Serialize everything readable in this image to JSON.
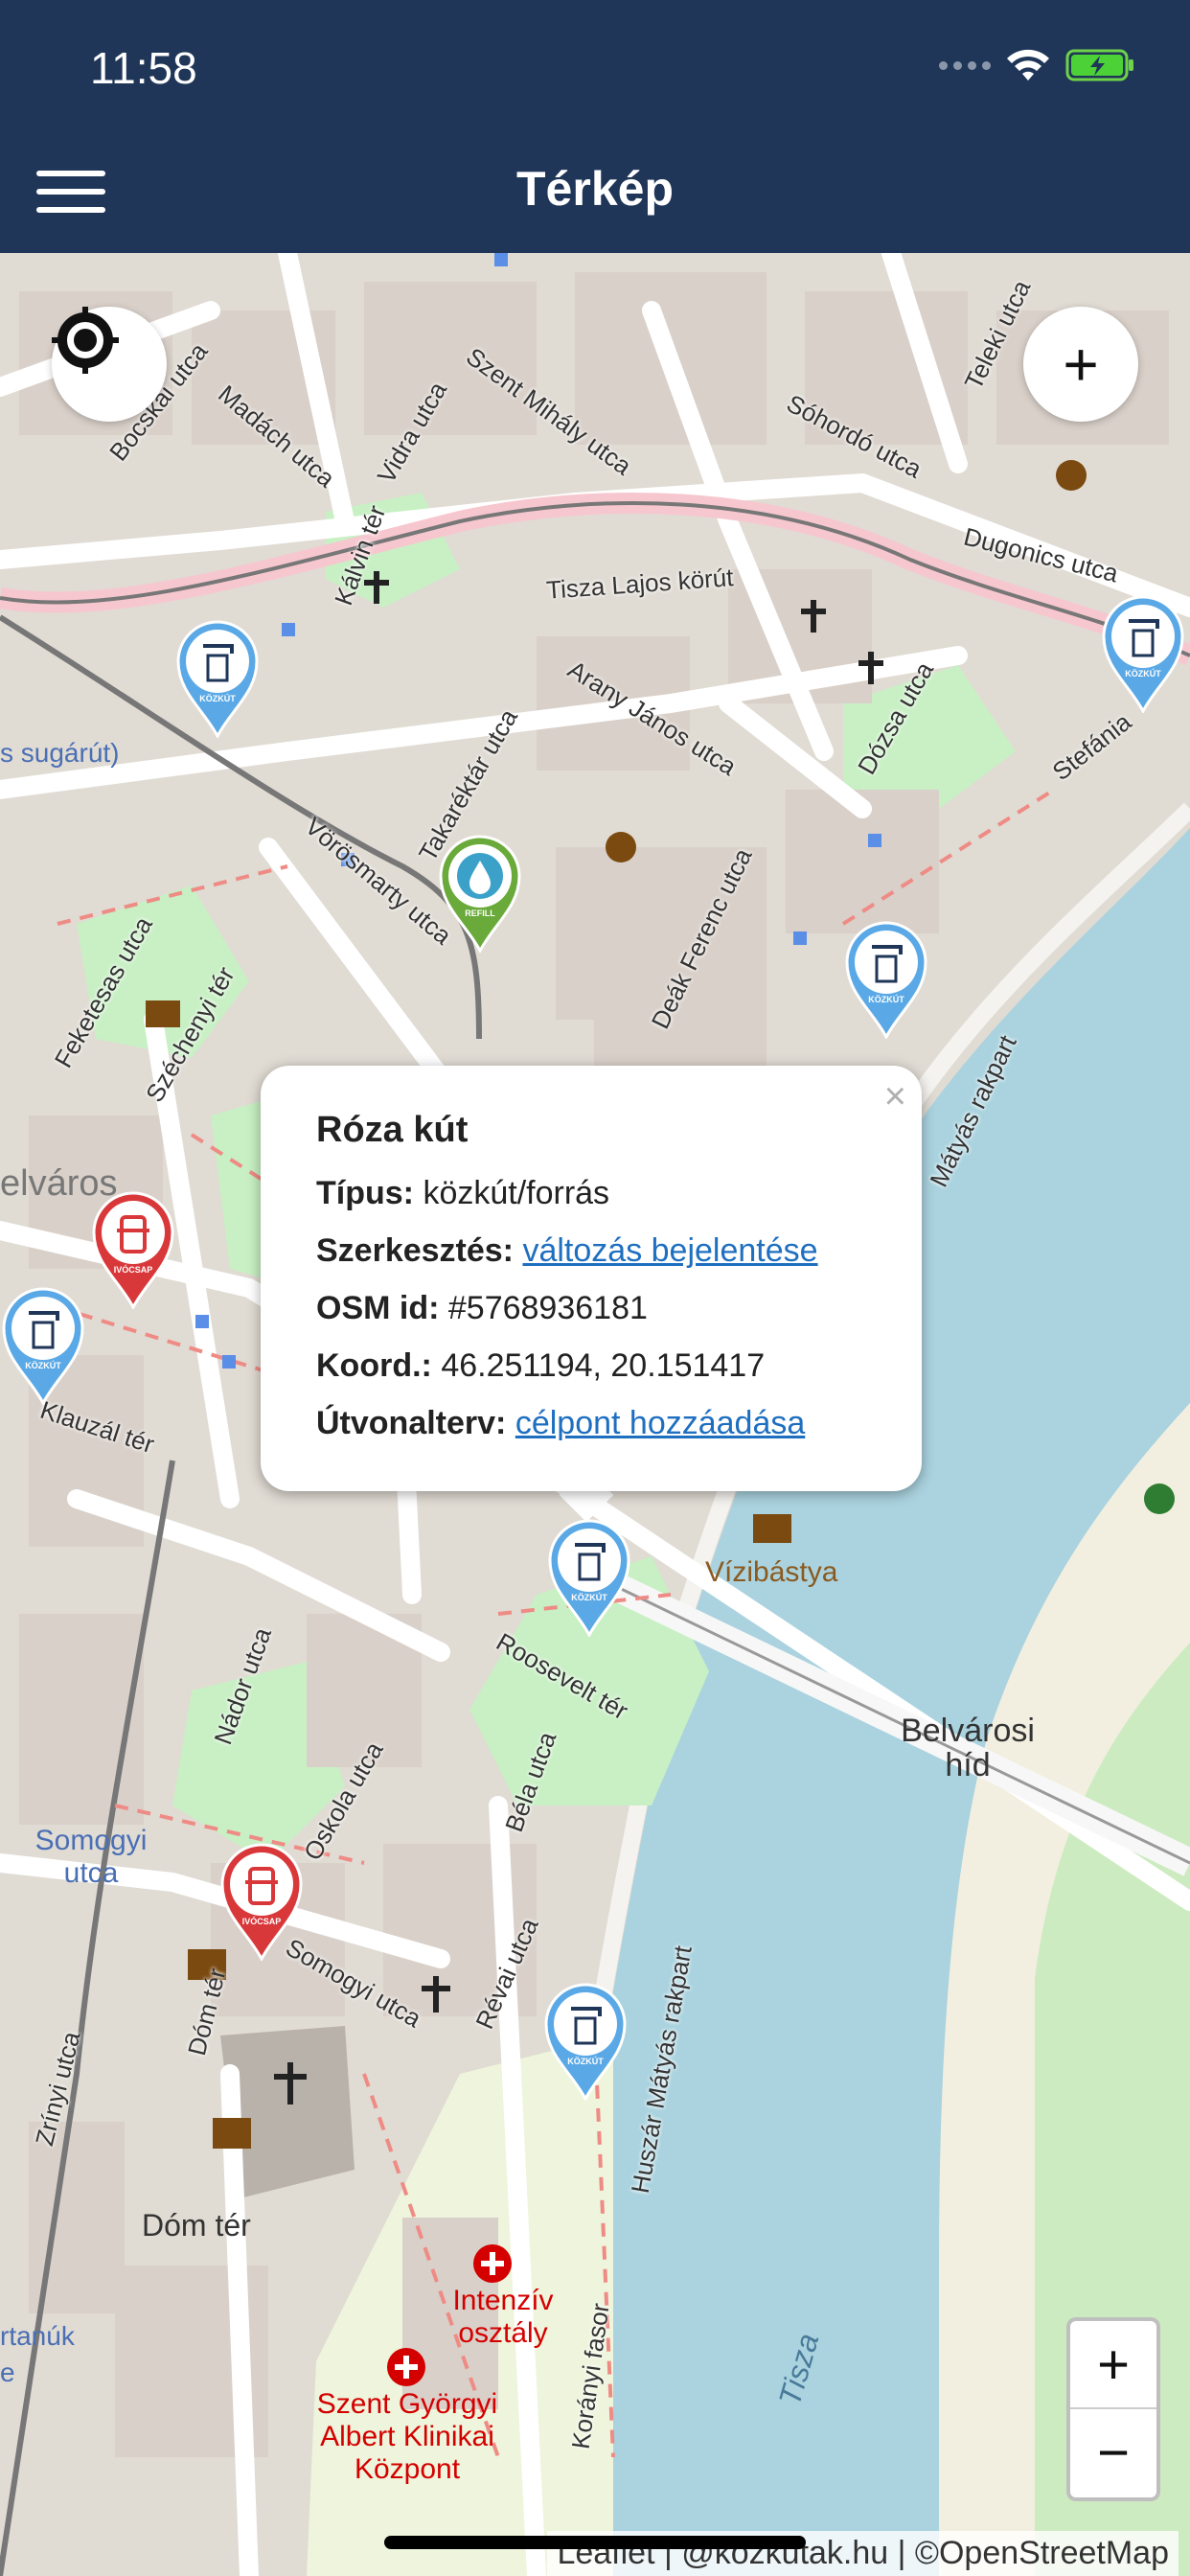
{
  "status": {
    "time": "11:58"
  },
  "header": {
    "title": "Térkép"
  },
  "map": {
    "labels": {
      "tisza_lajos": "Tisza Lajos körút",
      "dugonics": "Dugonics utca",
      "sohordo": "Sóhordó utca",
      "teleki": "Teleki utca",
      "arany_janos": "Arany János utca",
      "dozsa": "Dózsa utca",
      "stefania": "Stefánia",
      "szent_mihaly": "Szent Mihály utca",
      "vidra": "Vidra utca",
      "madach": "Madách utca",
      "bocskai": "Bocskai utca",
      "kalvin": "Kálvin tér",
      "takarekta": "Takaréktár utca",
      "vorosmarty": "Vörösmarty utca",
      "deak_ferenc": "Deák Ferenc utca",
      "feketesas": "Feketesas utca",
      "szechenyi_ter": "Széchenyi tér",
      "belvaros": "elváros",
      "klauzal": "Klauzál tér",
      "nador": "Nádor utca",
      "oskola": "Oskola utca",
      "roosevelt": "Roosevelt tér",
      "bela": "Béla utca",
      "somogyi": "Somogyi utca",
      "somogyi_street": "Somogyi utca",
      "dom_ter_street": "Dóm tér",
      "dom_ter": "Dóm tér",
      "revai": "Révai utca",
      "zrinyi": "Zrínyi utca",
      "korany": "Korányi fasor",
      "huszar": "Huszár Mátyás rakpart",
      "matyas": "Mátyás rakpart",
      "vizibastya": "Vízibástya",
      "belvarosi_hid": "Belvárosi híd",
      "tisza": "Tisza",
      "intenziv": "Intenzív osztály",
      "szent_gyorgyi": "Szent Györgyi Albert Klinikai Központ",
      "sugarut": "s sugárút)",
      "martanuk": "rtanúk",
      "e": "e"
    }
  },
  "pins": {
    "kozkut_label": "KÖZKÚT",
    "ivocsap_label": "IVÓCSAP",
    "refill_label": "REFILL"
  },
  "popup": {
    "close": "×",
    "title": "Róza kút",
    "type_label": "Típus:",
    "type_value": "közkút/forrás",
    "edit_label": "Szerkesztés:",
    "edit_link": "változás bejelentése",
    "osm_label": "OSM id:",
    "osm_value": "#5768936181",
    "coord_label": "Koord.:",
    "coord_value": "46.251194, 20.151417",
    "route_label": "Útvonalterv:",
    "route_link": "célpont hozzáadása"
  },
  "controls": {
    "zoom_in": "+",
    "zoom_out": "−",
    "add": "+"
  },
  "attribution": "Leaflet | @kozkutak.hu | ©OpenStreetMap",
  "colors": {
    "header": "#1f3658",
    "kozkut_pin": "#5aa9e6",
    "ivocsap_pin": "#d9383a",
    "refill_pin": "#6aaa3a",
    "water": "#aad3df",
    "park": "#c8f0c4"
  }
}
